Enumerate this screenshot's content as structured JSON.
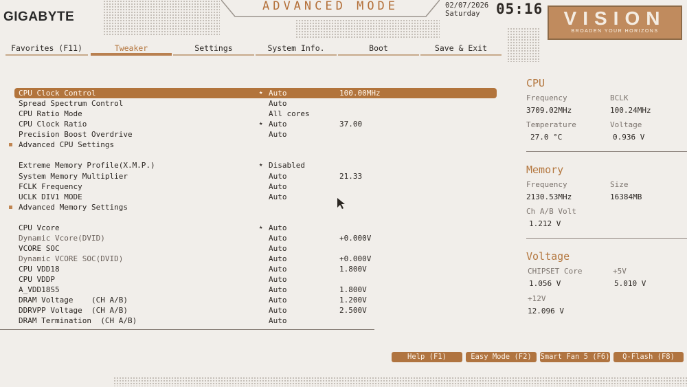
{
  "header": {
    "brand": "GIGABYTE",
    "mode_title": "ADVANCED MODE",
    "date": "02/07/2026",
    "day": "Saturday",
    "time": "05:16",
    "vision_logo": "VISION",
    "vision_tagline": "BROADEN YOUR HORIZONS"
  },
  "tabs": [
    {
      "label": "Favorites (F11)",
      "active": false
    },
    {
      "label": "Tweaker",
      "active": true
    },
    {
      "label": "Settings",
      "active": false
    },
    {
      "label": "System Info.",
      "active": false
    },
    {
      "label": "Boot",
      "active": false
    },
    {
      "label": "Save & Exit",
      "active": false
    }
  ],
  "settings": [
    {
      "label": "CPU Clock Control",
      "value": "Auto",
      "value2": "100.00MHz",
      "star": true,
      "selected": true
    },
    {
      "label": "Spread Spectrum Control",
      "value": "Auto"
    },
    {
      "label": "CPU Ratio Mode",
      "value": "All cores"
    },
    {
      "label": "CPU Clock Ratio",
      "value": "Auto",
      "value2": "37.00",
      "star": true
    },
    {
      "label": "Precision Boost Overdrive",
      "value": "Auto"
    },
    {
      "label": "Advanced CPU Settings",
      "submenu": true
    },
    {
      "label": "Extreme Memory Profile(X.M.P.)",
      "value": "Disabled",
      "star": true
    },
    {
      "label": "System Memory Multiplier",
      "value": "Auto",
      "value2": "21.33"
    },
    {
      "label": "FCLK Frequency",
      "value": "Auto"
    },
    {
      "label": "UCLK DIV1 MODE",
      "value": "Auto"
    },
    {
      "label": "Advanced Memory Settings",
      "submenu": true
    },
    {
      "label": "CPU Vcore",
      "value": "Auto",
      "star": true
    },
    {
      "label": "Dynamic Vcore(DVID)",
      "value": "Auto",
      "value2": "+0.000V",
      "dim": true
    },
    {
      "label": "VCORE SOC",
      "value": "Auto"
    },
    {
      "label": "Dynamic VCORE SOC(DVID)",
      "value": "Auto",
      "value2": "+0.000V",
      "dim": true
    },
    {
      "label": "CPU VDD18",
      "value": "Auto",
      "value2": "1.800V"
    },
    {
      "label": "CPU VDDP",
      "value": "Auto"
    },
    {
      "label": "A_VDD18S5",
      "value": "Auto",
      "value2": "1.800V"
    },
    {
      "label": "DRAM Voltage    (CH A/B)",
      "value": "Auto",
      "value2": "1.200V"
    },
    {
      "label": "DDRVPP Voltage  (CH A/B)",
      "value": "Auto",
      "value2": "2.500V"
    },
    {
      "label": "DRAM Termination  (CH A/B)",
      "value": "Auto"
    }
  ],
  "panel": {
    "cpu": {
      "title": "CPU",
      "frequency_label": "Frequency",
      "frequency": "3709.02MHz",
      "bclk_label": "BCLK",
      "bclk": "100.24MHz",
      "temperature_label": "Temperature",
      "temperature": "27.0 °C",
      "voltage_label": "Voltage",
      "voltage": "0.936 V"
    },
    "memory": {
      "title": "Memory",
      "frequency_label": "Frequency",
      "frequency": "2130.53MHz",
      "size_label": "Size",
      "size": "16384MB",
      "volt_label": "Ch A/B Volt",
      "volt": "1.212 V"
    },
    "voltage": {
      "title": "Voltage",
      "chipset_label": "CHIPSET Core",
      "chipset": "1.056 V",
      "v5_label": "+5V",
      "v5": "5.010 V",
      "v12_label": "+12V",
      "v12": "12.096 V"
    }
  },
  "buttons": {
    "help": "Help (F1)",
    "easy_mode": "Easy Mode (F2)",
    "smart_fan": "Smart Fan 5 (F6)",
    "qflash": "Q-Flash (F8)"
  },
  "colors": {
    "accent": "#b2743c",
    "background": "#f1eeea"
  }
}
